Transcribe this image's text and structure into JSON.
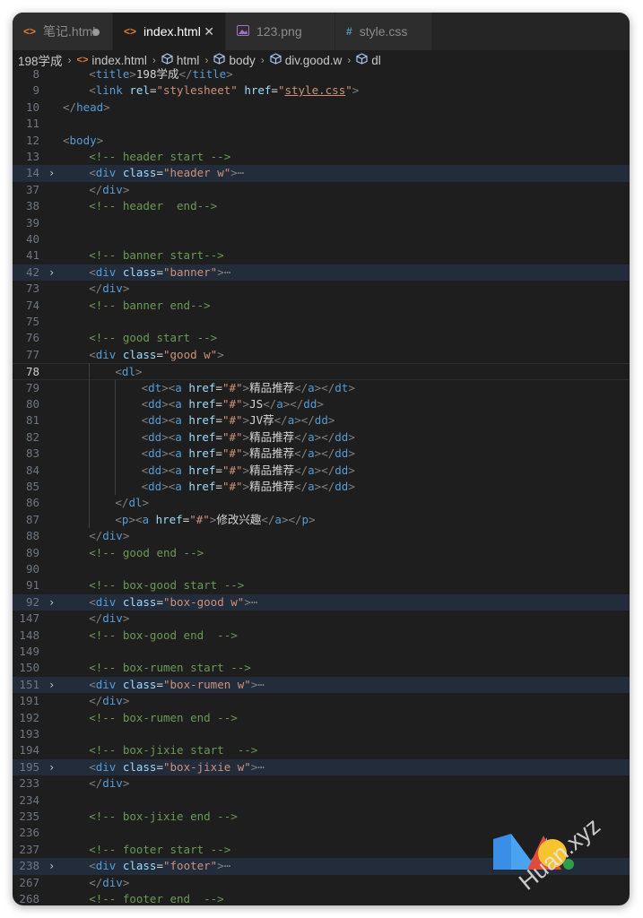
{
  "tabs": [
    {
      "icon": "<>",
      "label": "笔记.html",
      "icon_color": "#e37933",
      "state": "modified"
    },
    {
      "icon": "<>",
      "label": "index.html",
      "icon_color": "#e37933",
      "state": "active"
    },
    {
      "icon": "img",
      "label": "123.png",
      "icon_color": "#a074c4",
      "state": "normal"
    },
    {
      "icon": "#",
      "label": "style.css",
      "icon_color": "#519aba",
      "state": "normal"
    }
  ],
  "tab_close_glyph": "✕",
  "breadcrumb": [
    {
      "label": "198学成",
      "icon": ""
    },
    {
      "label": "index.html",
      "icon": "html-file-icon"
    },
    {
      "label": "html",
      "icon": "symbol-icon"
    },
    {
      "label": "body",
      "icon": "symbol-icon"
    },
    {
      "label": "div.good.w",
      "icon": "symbol-icon"
    },
    {
      "label": "dl",
      "icon": "symbol-icon"
    }
  ],
  "code_lines": [
    {
      "n": "8",
      "indent": 1,
      "fold": false,
      "hl": false,
      "tokens": [
        [
          "b",
          "<"
        ],
        [
          "t",
          "title"
        ],
        [
          "b",
          ">"
        ],
        [
          "x",
          "198学成"
        ],
        [
          "b",
          "</"
        ],
        [
          "t",
          "title"
        ],
        [
          "b",
          ">"
        ]
      ]
    },
    {
      "n": "9",
      "indent": 1,
      "fold": false,
      "hl": false,
      "tokens": [
        [
          "b",
          "<"
        ],
        [
          "t",
          "link"
        ],
        [
          "x",
          " "
        ],
        [
          "a",
          "rel"
        ],
        [
          "x",
          "="
        ],
        [
          "s",
          "\"stylesheet\""
        ],
        [
          "x",
          " "
        ],
        [
          "a",
          "href"
        ],
        [
          "x",
          "="
        ],
        [
          "s",
          "\""
        ],
        [
          "u",
          "style.css"
        ],
        [
          "s",
          "\""
        ],
        [
          "b",
          ">"
        ]
      ]
    },
    {
      "n": "10",
      "indent": 0,
      "fold": false,
      "hl": false,
      "tokens": [
        [
          "b",
          "</"
        ],
        [
          "t",
          "head"
        ],
        [
          "b",
          ">"
        ]
      ]
    },
    {
      "n": "11",
      "indent": 0,
      "fold": false,
      "hl": false,
      "tokens": []
    },
    {
      "n": "12",
      "indent": 0,
      "fold": false,
      "hl": false,
      "tokens": [
        [
          "b",
          "<"
        ],
        [
          "t",
          "body"
        ],
        [
          "b",
          ">"
        ]
      ]
    },
    {
      "n": "13",
      "indent": 1,
      "fold": false,
      "hl": false,
      "tokens": [
        [
          "c",
          "<!-- header start -->"
        ]
      ]
    },
    {
      "n": "14",
      "indent": 1,
      "fold": true,
      "hl": true,
      "tokens": [
        [
          "b",
          "<"
        ],
        [
          "t",
          "div"
        ],
        [
          "x",
          " "
        ],
        [
          "a",
          "class"
        ],
        [
          "x",
          "="
        ],
        [
          "s",
          "\"header w\""
        ],
        [
          "b",
          ">"
        ],
        [
          "f",
          "⋯"
        ]
      ]
    },
    {
      "n": "37",
      "indent": 1,
      "fold": false,
      "hl": false,
      "tokens": [
        [
          "b",
          "</"
        ],
        [
          "t",
          "div"
        ],
        [
          "b",
          ">"
        ]
      ]
    },
    {
      "n": "38",
      "indent": 1,
      "fold": false,
      "hl": false,
      "tokens": [
        [
          "c",
          "<!-- header  end-->"
        ]
      ]
    },
    {
      "n": "39",
      "indent": 0,
      "fold": false,
      "hl": false,
      "tokens": []
    },
    {
      "n": "40",
      "indent": 0,
      "fold": false,
      "hl": false,
      "tokens": []
    },
    {
      "n": "41",
      "indent": 1,
      "fold": false,
      "hl": false,
      "tokens": [
        [
          "c",
          "<!-- banner start-->"
        ]
      ]
    },
    {
      "n": "42",
      "indent": 1,
      "fold": true,
      "hl": true,
      "tokens": [
        [
          "b",
          "<"
        ],
        [
          "t",
          "div"
        ],
        [
          "x",
          " "
        ],
        [
          "a",
          "class"
        ],
        [
          "x",
          "="
        ],
        [
          "s",
          "\"banner\""
        ],
        [
          "b",
          ">"
        ],
        [
          "f",
          "⋯"
        ]
      ]
    },
    {
      "n": "73",
      "indent": 1,
      "fold": false,
      "hl": false,
      "tokens": [
        [
          "b",
          "</"
        ],
        [
          "t",
          "div"
        ],
        [
          "b",
          ">"
        ]
      ]
    },
    {
      "n": "74",
      "indent": 1,
      "fold": false,
      "hl": false,
      "tokens": [
        [
          "c",
          "<!-- banner end-->"
        ]
      ]
    },
    {
      "n": "75",
      "indent": 0,
      "fold": false,
      "hl": false,
      "tokens": []
    },
    {
      "n": "76",
      "indent": 1,
      "fold": false,
      "hl": false,
      "tokens": [
        [
          "c",
          "<!-- good start -->"
        ]
      ]
    },
    {
      "n": "77",
      "indent": 1,
      "fold": false,
      "hl": false,
      "tokens": [
        [
          "b",
          "<"
        ],
        [
          "t",
          "div"
        ],
        [
          "x",
          " "
        ],
        [
          "a",
          "class"
        ],
        [
          "x",
          "="
        ],
        [
          "s",
          "\"good w\""
        ],
        [
          "b",
          ">"
        ]
      ]
    },
    {
      "n": "78",
      "indent": 2,
      "fold": false,
      "hl": false,
      "cur": true,
      "tokens": [
        [
          "b",
          "<"
        ],
        [
          "t",
          "dl"
        ],
        [
          "b",
          ">"
        ]
      ]
    },
    {
      "n": "79",
      "indent": 3,
      "fold": false,
      "hl": false,
      "tokens": [
        [
          "b",
          "<"
        ],
        [
          "t",
          "dt"
        ],
        [
          "b",
          "><"
        ],
        [
          "t",
          "a"
        ],
        [
          "x",
          " "
        ],
        [
          "a",
          "href"
        ],
        [
          "x",
          "="
        ],
        [
          "s",
          "\"#\""
        ],
        [
          "b",
          ">"
        ],
        [
          "x",
          "精品推荐"
        ],
        [
          "b",
          "</"
        ],
        [
          "t",
          "a"
        ],
        [
          "b",
          "></"
        ],
        [
          "t",
          "dt"
        ],
        [
          "b",
          ">"
        ]
      ]
    },
    {
      "n": "80",
      "indent": 3,
      "fold": false,
      "hl": false,
      "tokens": [
        [
          "b",
          "<"
        ],
        [
          "t",
          "dd"
        ],
        [
          "b",
          "><"
        ],
        [
          "t",
          "a"
        ],
        [
          "x",
          " "
        ],
        [
          "a",
          "href"
        ],
        [
          "x",
          "="
        ],
        [
          "s",
          "\"#\""
        ],
        [
          "b",
          ">"
        ],
        [
          "x",
          "JS"
        ],
        [
          "b",
          "</"
        ],
        [
          "t",
          "a"
        ],
        [
          "b",
          "></"
        ],
        [
          "t",
          "dd"
        ],
        [
          "b",
          ">"
        ]
      ]
    },
    {
      "n": "81",
      "indent": 3,
      "fold": false,
      "hl": false,
      "tokens": [
        [
          "b",
          "<"
        ],
        [
          "t",
          "dd"
        ],
        [
          "b",
          "><"
        ],
        [
          "t",
          "a"
        ],
        [
          "x",
          " "
        ],
        [
          "a",
          "href"
        ],
        [
          "x",
          "="
        ],
        [
          "s",
          "\"#\""
        ],
        [
          "b",
          ">"
        ],
        [
          "x",
          "JV荐"
        ],
        [
          "b",
          "</"
        ],
        [
          "t",
          "a"
        ],
        [
          "b",
          "></"
        ],
        [
          "t",
          "dd"
        ],
        [
          "b",
          ">"
        ]
      ]
    },
    {
      "n": "82",
      "indent": 3,
      "fold": false,
      "hl": false,
      "tokens": [
        [
          "b",
          "<"
        ],
        [
          "t",
          "dd"
        ],
        [
          "b",
          "><"
        ],
        [
          "t",
          "a"
        ],
        [
          "x",
          " "
        ],
        [
          "a",
          "href"
        ],
        [
          "x",
          "="
        ],
        [
          "s",
          "\"#\""
        ],
        [
          "b",
          ">"
        ],
        [
          "x",
          "精品推荐"
        ],
        [
          "b",
          "</"
        ],
        [
          "t",
          "a"
        ],
        [
          "b",
          "></"
        ],
        [
          "t",
          "dd"
        ],
        [
          "b",
          ">"
        ]
      ]
    },
    {
      "n": "83",
      "indent": 3,
      "fold": false,
      "hl": false,
      "tokens": [
        [
          "b",
          "<"
        ],
        [
          "t",
          "dd"
        ],
        [
          "b",
          "><"
        ],
        [
          "t",
          "a"
        ],
        [
          "x",
          " "
        ],
        [
          "a",
          "href"
        ],
        [
          "x",
          "="
        ],
        [
          "s",
          "\"#\""
        ],
        [
          "b",
          ">"
        ],
        [
          "x",
          "精品推荐"
        ],
        [
          "b",
          "</"
        ],
        [
          "t",
          "a"
        ],
        [
          "b",
          "></"
        ],
        [
          "t",
          "dd"
        ],
        [
          "b",
          ">"
        ]
      ]
    },
    {
      "n": "84",
      "indent": 3,
      "fold": false,
      "hl": false,
      "tokens": [
        [
          "b",
          "<"
        ],
        [
          "t",
          "dd"
        ],
        [
          "b",
          "><"
        ],
        [
          "t",
          "a"
        ],
        [
          "x",
          " "
        ],
        [
          "a",
          "href"
        ],
        [
          "x",
          "="
        ],
        [
          "s",
          "\"#\""
        ],
        [
          "b",
          ">"
        ],
        [
          "x",
          "精品推荐"
        ],
        [
          "b",
          "</"
        ],
        [
          "t",
          "a"
        ],
        [
          "b",
          "></"
        ],
        [
          "t",
          "dd"
        ],
        [
          "b",
          ">"
        ]
      ]
    },
    {
      "n": "85",
      "indent": 3,
      "fold": false,
      "hl": false,
      "tokens": [
        [
          "b",
          "<"
        ],
        [
          "t",
          "dd"
        ],
        [
          "b",
          "><"
        ],
        [
          "t",
          "a"
        ],
        [
          "x",
          " "
        ],
        [
          "a",
          "href"
        ],
        [
          "x",
          "="
        ],
        [
          "s",
          "\"#\""
        ],
        [
          "b",
          ">"
        ],
        [
          "x",
          "精品推荐"
        ],
        [
          "b",
          "</"
        ],
        [
          "t",
          "a"
        ],
        [
          "b",
          "></"
        ],
        [
          "t",
          "dd"
        ],
        [
          "b",
          ">"
        ]
      ]
    },
    {
      "n": "86",
      "indent": 2,
      "fold": false,
      "hl": false,
      "tokens": [
        [
          "b",
          "</"
        ],
        [
          "t",
          "dl"
        ],
        [
          "b",
          ">"
        ]
      ]
    },
    {
      "n": "87",
      "indent": 2,
      "fold": false,
      "hl": false,
      "tokens": [
        [
          "b",
          "<"
        ],
        [
          "t",
          "p"
        ],
        [
          "b",
          "><"
        ],
        [
          "t",
          "a"
        ],
        [
          "x",
          " "
        ],
        [
          "a",
          "href"
        ],
        [
          "x",
          "="
        ],
        [
          "s",
          "\"#\""
        ],
        [
          "b",
          ">"
        ],
        [
          "x",
          "修改兴趣"
        ],
        [
          "b",
          "</"
        ],
        [
          "t",
          "a"
        ],
        [
          "b",
          "></"
        ],
        [
          "t",
          "p"
        ],
        [
          "b",
          ">"
        ]
      ]
    },
    {
      "n": "88",
      "indent": 1,
      "fold": false,
      "hl": false,
      "tokens": [
        [
          "b",
          "</"
        ],
        [
          "t",
          "div"
        ],
        [
          "b",
          ">"
        ]
      ]
    },
    {
      "n": "89",
      "indent": 1,
      "fold": false,
      "hl": false,
      "tokens": [
        [
          "c",
          "<!-- good end -->"
        ]
      ]
    },
    {
      "n": "90",
      "indent": 0,
      "fold": false,
      "hl": false,
      "tokens": []
    },
    {
      "n": "91",
      "indent": 1,
      "fold": false,
      "hl": false,
      "tokens": [
        [
          "c",
          "<!-- box-good start -->"
        ]
      ]
    },
    {
      "n": "92",
      "indent": 1,
      "fold": true,
      "hl": true,
      "tokens": [
        [
          "b",
          "<"
        ],
        [
          "t",
          "div"
        ],
        [
          "x",
          " "
        ],
        [
          "a",
          "class"
        ],
        [
          "x",
          "="
        ],
        [
          "s",
          "\"box-good w\""
        ],
        [
          "b",
          ">"
        ],
        [
          "f",
          "⋯"
        ]
      ]
    },
    {
      "n": "147",
      "indent": 1,
      "fold": false,
      "hl": false,
      "tokens": [
        [
          "b",
          "</"
        ],
        [
          "t",
          "div"
        ],
        [
          "b",
          ">"
        ]
      ]
    },
    {
      "n": "148",
      "indent": 1,
      "fold": false,
      "hl": false,
      "tokens": [
        [
          "c",
          "<!-- box-good end  -->"
        ]
      ]
    },
    {
      "n": "149",
      "indent": 0,
      "fold": false,
      "hl": false,
      "tokens": []
    },
    {
      "n": "150",
      "indent": 1,
      "fold": false,
      "hl": false,
      "tokens": [
        [
          "c",
          "<!-- box-rumen start -->"
        ]
      ]
    },
    {
      "n": "151",
      "indent": 1,
      "fold": true,
      "hl": true,
      "tokens": [
        [
          "b",
          "<"
        ],
        [
          "t",
          "div"
        ],
        [
          "x",
          " "
        ],
        [
          "a",
          "class"
        ],
        [
          "x",
          "="
        ],
        [
          "s",
          "\"box-rumen w\""
        ],
        [
          "b",
          ">"
        ],
        [
          "f",
          "⋯"
        ]
      ]
    },
    {
      "n": "191",
      "indent": 1,
      "fold": false,
      "hl": false,
      "tokens": [
        [
          "b",
          "</"
        ],
        [
          "t",
          "div"
        ],
        [
          "b",
          ">"
        ]
      ]
    },
    {
      "n": "192",
      "indent": 1,
      "fold": false,
      "hl": false,
      "tokens": [
        [
          "c",
          "<!-- box-rumen end -->"
        ]
      ]
    },
    {
      "n": "193",
      "indent": 0,
      "fold": false,
      "hl": false,
      "tokens": []
    },
    {
      "n": "194",
      "indent": 1,
      "fold": false,
      "hl": false,
      "tokens": [
        [
          "c",
          "<!-- box-jixie start  -->"
        ]
      ]
    },
    {
      "n": "195",
      "indent": 1,
      "fold": true,
      "hl": true,
      "tokens": [
        [
          "b",
          "<"
        ],
        [
          "t",
          "div"
        ],
        [
          "x",
          " "
        ],
        [
          "a",
          "class"
        ],
        [
          "x",
          "="
        ],
        [
          "s",
          "\"box-jixie w\""
        ],
        [
          "b",
          ">"
        ],
        [
          "f",
          "⋯"
        ]
      ]
    },
    {
      "n": "233",
      "indent": 1,
      "fold": false,
      "hl": false,
      "tokens": [
        [
          "b",
          "</"
        ],
        [
          "t",
          "div"
        ],
        [
          "b",
          ">"
        ]
      ]
    },
    {
      "n": "234",
      "indent": 0,
      "fold": false,
      "hl": false,
      "tokens": []
    },
    {
      "n": "235",
      "indent": 1,
      "fold": false,
      "hl": false,
      "tokens": [
        [
          "c",
          "<!-- box-jixie end -->"
        ]
      ]
    },
    {
      "n": "236",
      "indent": 0,
      "fold": false,
      "hl": false,
      "tokens": []
    },
    {
      "n": "237",
      "indent": 1,
      "fold": false,
      "hl": false,
      "tokens": [
        [
          "c",
          "<!-- footer start -->"
        ]
      ]
    },
    {
      "n": "238",
      "indent": 1,
      "fold": true,
      "hl": true,
      "tokens": [
        [
          "b",
          "<"
        ],
        [
          "t",
          "div"
        ],
        [
          "x",
          " "
        ],
        [
          "a",
          "class"
        ],
        [
          "x",
          "="
        ],
        [
          "s",
          "\"footer\""
        ],
        [
          "b",
          ">"
        ],
        [
          "f",
          "⋯"
        ]
      ]
    },
    {
      "n": "267",
      "indent": 1,
      "fold": false,
      "hl": false,
      "tokens": [
        [
          "b",
          "</"
        ],
        [
          "t",
          "div"
        ],
        [
          "b",
          ">"
        ]
      ]
    },
    {
      "n": "268",
      "indent": 1,
      "fold": false,
      "hl": false,
      "tokens": [
        [
          "c",
          "<!-- footer end  -->"
        ]
      ]
    }
  ],
  "colors": {
    "editor_bg": "#1e1e1e",
    "tabbar_bg": "#252526",
    "fold_highlight": "#222c3a",
    "tag": "#569cd6",
    "attr": "#9cdcfe",
    "string": "#ce9178",
    "comment": "#6a9955",
    "bracket": "#808080"
  },
  "watermark": {
    "text": "Huan.xyz"
  }
}
